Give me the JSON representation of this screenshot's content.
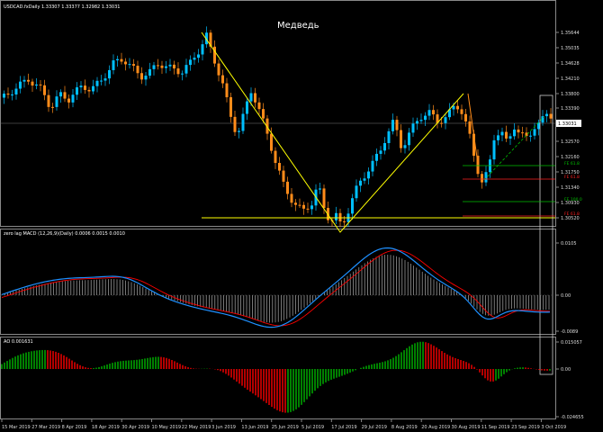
{
  "main": {
    "symbol_line": "USDCAD.fxDaily  1.33307 1.33377 1.32982 1.33031",
    "annotation": "Медведь",
    "price_ticks": [
      "1.35644",
      "1.35035",
      "1.34628",
      "1.34210",
      "1.33800",
      "1.33390",
      "1.33031",
      "1.32570",
      "1.32160",
      "1.31750",
      "1.31340",
      "1.30930",
      "1.30520",
      "1.30110"
    ],
    "current_price": "1.33031",
    "fib_labels": [
      "FE 61.8",
      "FE 61.8",
      "FE 100.0",
      "FE 61.8"
    ],
    "fib_colors": [
      "#00c000",
      "#ff2020",
      "#00c000",
      "#ff2020"
    ]
  },
  "macd": {
    "title": "zero lag MACD (12,26,9)(Daily) 0.0006 0.0015 0.0010",
    "ticks": [
      "0.0105",
      "0.00",
      "-0.0089"
    ]
  },
  "ao": {
    "title": "AO 0.001631",
    "ticks": [
      "0.015057",
      "0.00",
      "-0.024655"
    ]
  },
  "dates": [
    "15 Mar 2019",
    "27 Mar 2019",
    "8 Apr 2019",
    "18 Apr 2019",
    "30 Apr 2019",
    "10 May 2019",
    "22 May 2019",
    "3 Jun 2019",
    "13 Jun 2019",
    "25 Jun 2019",
    "5 Jul 2019",
    "17 Jul 2019",
    "29 Jul 2019",
    "8 Aug 2019",
    "20 Aug 2019",
    "30 Aug 2019",
    "11 Sep 2019",
    "23 Sep 2019",
    "3 Oct 2019"
  ],
  "colors": {
    "bull": "#00bfff",
    "bear": "#ff8c1a",
    "trend": "#ffff00",
    "macd_line": "#1e90ff",
    "signal": "#ff0000",
    "ao_up": "#00a000",
    "ao_down": "#e00000"
  }
}
